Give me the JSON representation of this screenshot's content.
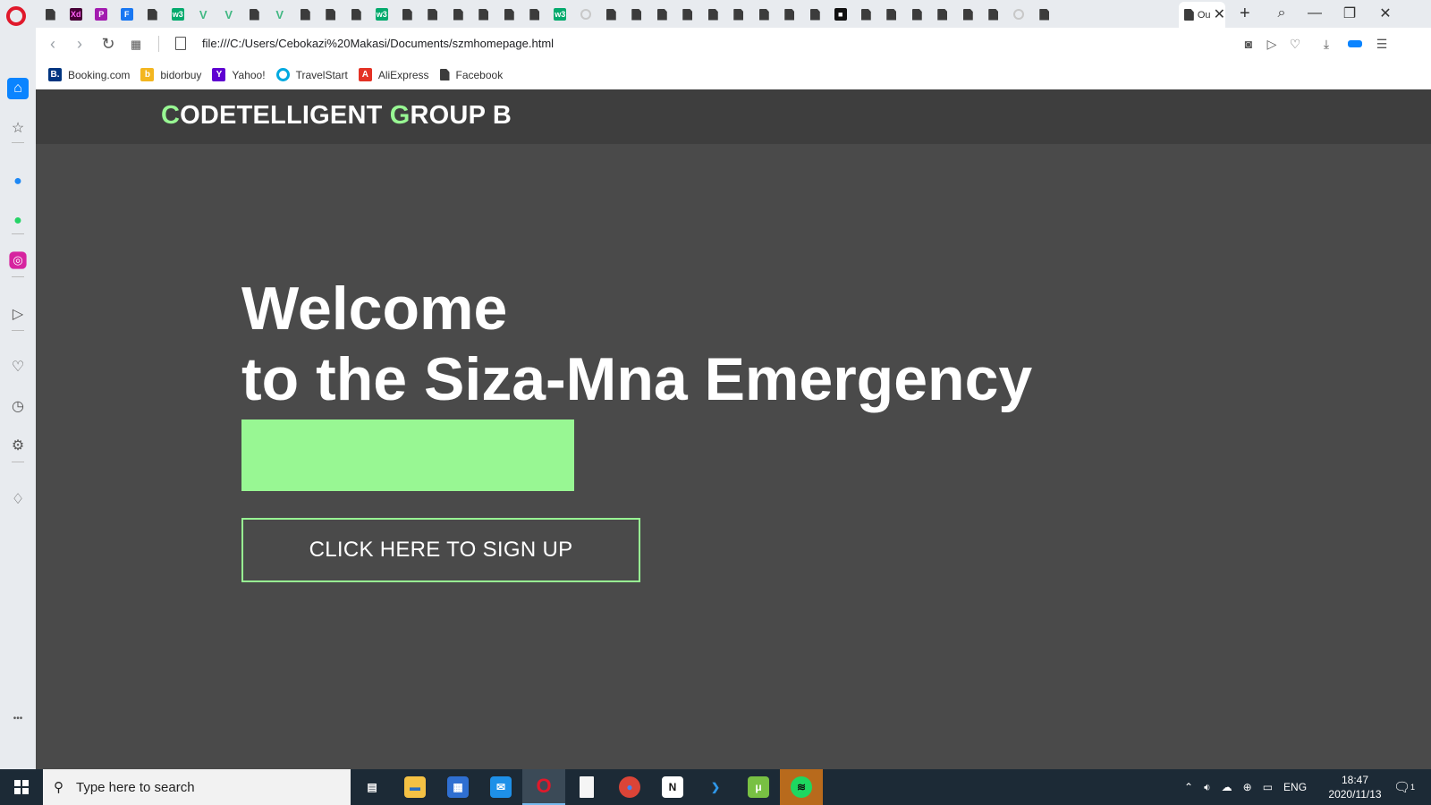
{
  "browser": {
    "active_tab_title": "Ou",
    "url": "file:///C:/Users/Cebokazi%20Makasi/Documents/szmhomepage.html",
    "tab_icons": [
      "doc",
      "xd",
      "pn",
      "f",
      "doc",
      "w3",
      "vue",
      "vue",
      "doc",
      "vue",
      "doc",
      "doc",
      "doc",
      "w3",
      "doc",
      "doc",
      "doc",
      "doc",
      "doc",
      "doc",
      "w3",
      "spin",
      "doc",
      "doc",
      "doc",
      "doc",
      "doc",
      "doc",
      "doc",
      "doc",
      "doc",
      "unsplash",
      "doc",
      "doc",
      "doc",
      "doc",
      "doc",
      "doc",
      "spin",
      "doc"
    ],
    "colors": {
      "opera_red": "#e0192b",
      "sidebar_active": "#0a84ff"
    }
  },
  "bookmarks": [
    {
      "label": "Booking.com",
      "icon": "B.",
      "color": "#003580"
    },
    {
      "label": "bidorbuy",
      "icon": "b",
      "color": "#f3b61f"
    },
    {
      "label": "Yahoo!",
      "icon": "Y",
      "color": "#5f01d1"
    },
    {
      "label": "TravelStart",
      "icon": "o",
      "color": "#00a9e0"
    },
    {
      "label": "AliExpress",
      "icon": "A",
      "color": "#e43225"
    },
    {
      "label": "Facebook",
      "icon": "doc",
      "color": "#555555"
    }
  ],
  "sidebar": [
    {
      "name": "home-icon",
      "glyph": "⌂",
      "active": true
    },
    {
      "name": "star-icon",
      "glyph": "☆"
    },
    {
      "name": "messenger-icon",
      "glyph": "●"
    },
    {
      "name": "whatsapp-icon",
      "glyph": "●"
    },
    {
      "name": "instagram-icon",
      "glyph": "◎"
    },
    {
      "name": "send-icon",
      "glyph": "▷"
    },
    {
      "name": "heart-icon",
      "glyph": "♡"
    },
    {
      "name": "history-icon",
      "glyph": "◷"
    },
    {
      "name": "settings-icon",
      "glyph": "⚙"
    },
    {
      "name": "tips-icon",
      "glyph": "♢"
    },
    {
      "name": "more-icon",
      "glyph": "•••"
    }
  ],
  "site": {
    "logo_initial_1": "C",
    "logo_rest_1": "ODETELLIGENT ",
    "logo_initial_2": "G",
    "logo_rest_2": "ROUP B",
    "hero_line_1": "Welcome",
    "hero_line_2": "to the Siza-Mna Emergency",
    "cta_label": "CLICK HERE TO SIGN UP",
    "colors": {
      "accent": "#98f793",
      "background": "#4a4a4a",
      "header": "#3e3e3e"
    }
  },
  "taskbar": {
    "search_placeholder": "Type here to search",
    "apps": [
      "task-view-icon",
      "file-explorer-icon",
      "store-icon",
      "mail-icon",
      "opera-icon",
      "notepad-icon",
      "chrome-icon",
      "notion-icon",
      "vscode-icon",
      "utorrent-icon",
      "spotify-icon"
    ],
    "language": "ENG",
    "time": "18:47",
    "date": "2020/11/13",
    "notification_count": "1"
  }
}
